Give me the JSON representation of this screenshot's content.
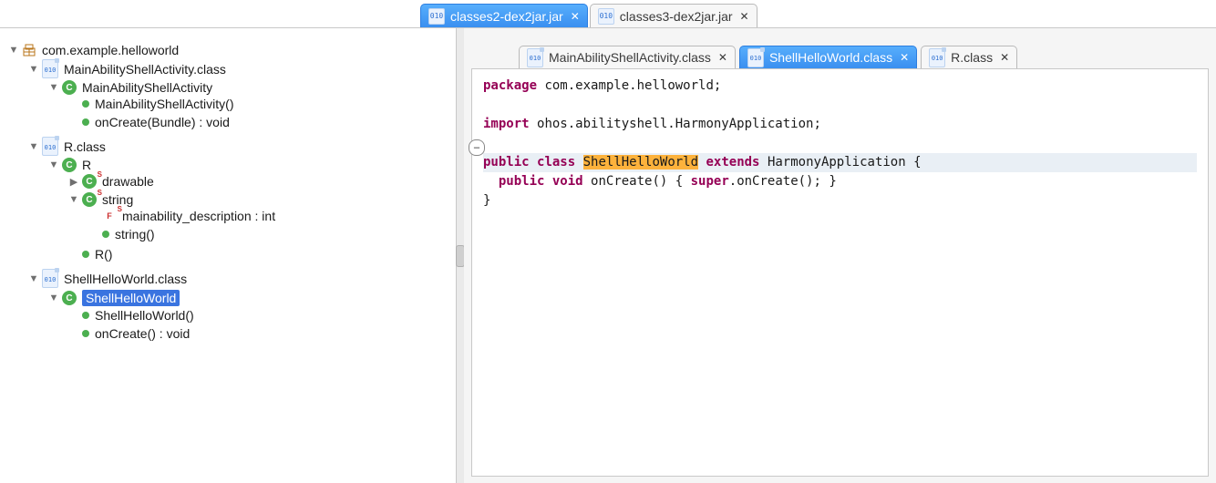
{
  "topTabs": [
    {
      "label": "classes2-dex2jar.jar",
      "active": true
    },
    {
      "label": "classes3-dex2jar.jar",
      "active": false
    }
  ],
  "editorTabs": [
    {
      "label": "MainAbilityShellActivity.class",
      "active": false
    },
    {
      "label": "ShellHelloWorld.class",
      "active": true
    },
    {
      "label": "R.class",
      "active": false
    }
  ],
  "tree": {
    "package": "com.example.helloworld",
    "mainClassFile": "MainAbilityShellActivity.class",
    "mainClassName": "MainAbilityShellActivity",
    "mainCtor": "MainAbilityShellActivity()",
    "mainOnCreate": "onCreate(Bundle) : void",
    "rClassFile": "R.class",
    "rClassName": "R",
    "rDrawable": "drawable",
    "rString": "string",
    "rStringField": "mainability_description : int",
    "rStringCtor": "string()",
    "rCtor": "R()",
    "shellClassFile": "ShellHelloWorld.class",
    "shellClassName": "ShellHelloWorld",
    "shellCtor": "ShellHelloWorld()",
    "shellOnCreate": "onCreate() : void"
  },
  "code": {
    "pkgKw": "package",
    "pkgName": "com.example.helloworld;",
    "impKw": "import",
    "impName": "ohos.abilityshell.HarmonyApplication;",
    "pub": "public",
    "cls": "class",
    "clsName": "ShellHelloWorld",
    "ext": "extends",
    "extName": "HarmonyApplication {",
    "void": "void",
    "method": "onCreate() { ",
    "sup": "super",
    "rest": ".onCreate(); }",
    "close": "}"
  },
  "glyph": {
    "close": "✕",
    "x": "✕",
    "tri_down": "▼",
    "tri_right": "▶",
    "fold": "−"
  }
}
